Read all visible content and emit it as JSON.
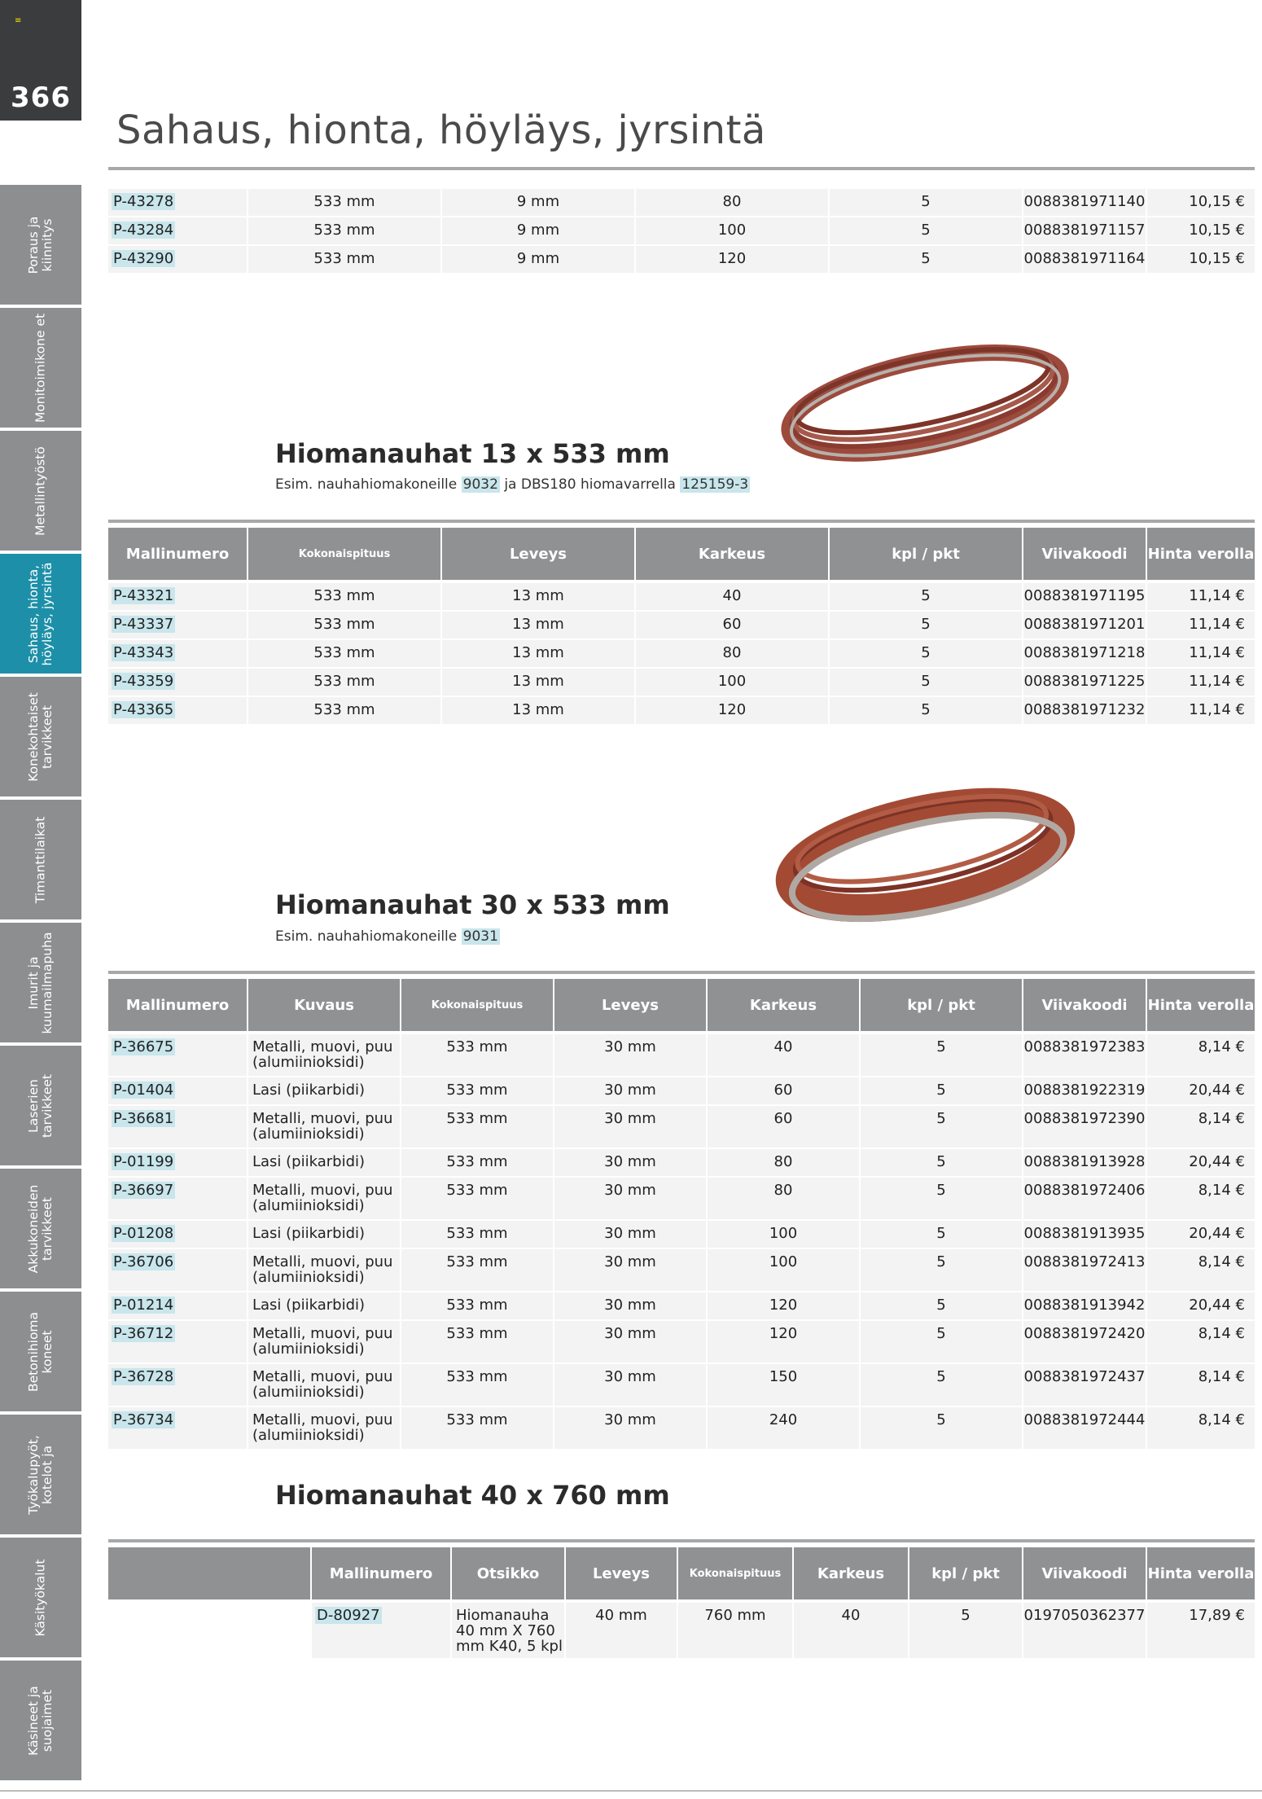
{
  "page": {
    "number": "366",
    "title": "Sahaus, hionta, höyläys, jyrsintä"
  },
  "side_tabs": [
    {
      "label": "Poraus ja kiinnitys",
      "active": false
    },
    {
      "label": "Monitoimikone et",
      "active": false
    },
    {
      "label": "Metallintyöstö",
      "active": false
    },
    {
      "label": "Sahaus, hionta, höyläys, jyrsintä",
      "active": true
    },
    {
      "label": "Konekohtaiset tarvikkeet",
      "active": false
    },
    {
      "label": "Timanttilaikat",
      "active": false
    },
    {
      "label": "Imurit ja kuumailmapuha",
      "active": false
    },
    {
      "label": "Laserien tarvikkeet",
      "active": false
    },
    {
      "label": "Akkukoneiden tarvikkeet",
      "active": false
    },
    {
      "label": "Betonihioma koneet",
      "active": false
    },
    {
      "label": "Työkalupyöt, kotelot ja",
      "active": false
    },
    {
      "label": "Käsityökalut",
      "active": false
    },
    {
      "label": "Käsineet ja suojaimet",
      "active": false
    }
  ],
  "table0": {
    "rows": [
      [
        "P-43278",
        "533 mm",
        "9 mm",
        "80",
        "5",
        "0088381971140",
        "10,15 €"
      ],
      [
        "P-43284",
        "533 mm",
        "9 mm",
        "100",
        "5",
        "0088381971157",
        "10,15 €"
      ],
      [
        "P-43290",
        "533 mm",
        "9 mm",
        "120",
        "5",
        "0088381971164",
        "10,15 €"
      ]
    ]
  },
  "section1": {
    "title": "Hiomanauhat 13 x 533 mm",
    "sub_prefix": "Esim. nauhahiomakoneille",
    "sub_link1": "9032",
    "sub_mid": "ja DBS180 hiomavarrella",
    "sub_link2": "125159-3",
    "headers": [
      "Mallinumero",
      "Kokonaispituus",
      "Leveys",
      "Karkeus",
      "kpl / pkt",
      "Viivakoodi",
      "Hinta verolla"
    ],
    "rows": [
      [
        "P-43321",
        "533 mm",
        "13 mm",
        "40",
        "5",
        "0088381971195",
        "11,14 €"
      ],
      [
        "P-43337",
        "533 mm",
        "13 mm",
        "60",
        "5",
        "0088381971201",
        "11,14 €"
      ],
      [
        "P-43343",
        "533 mm",
        "13 mm",
        "80",
        "5",
        "0088381971218",
        "11,14 €"
      ],
      [
        "P-43359",
        "533 mm",
        "13 mm",
        "100",
        "5",
        "0088381971225",
        "11,14 €"
      ],
      [
        "P-43365",
        "533 mm",
        "13 mm",
        "120",
        "5",
        "0088381971232",
        "11,14 €"
      ]
    ]
  },
  "section2": {
    "title": "Hiomanauhat 30 x 533 mm",
    "sub_prefix": "Esim. nauhahiomakoneille",
    "sub_link1": "9031",
    "headers": [
      "Mallinumero",
      "Kuvaus",
      "Kokonaispituus",
      "Leveys",
      "Karkeus",
      "kpl / pkt",
      "Viivakoodi",
      "Hinta verolla"
    ],
    "rows": [
      [
        "P-36675",
        "Metalli, muovi, puu (alumiinioksidi)",
        "533 mm",
        "30 mm",
        "40",
        "5",
        "0088381972383",
        "8,14 €"
      ],
      [
        "P-01404",
        "Lasi (piikarbidi)",
        "533 mm",
        "30 mm",
        "60",
        "5",
        "0088381922319",
        "20,44 €"
      ],
      [
        "P-36681",
        "Metalli, muovi, puu (alumiinioksidi)",
        "533 mm",
        "30 mm",
        "60",
        "5",
        "0088381972390",
        "8,14 €"
      ],
      [
        "P-01199",
        "Lasi (piikarbidi)",
        "533 mm",
        "30 mm",
        "80",
        "5",
        "0088381913928",
        "20,44 €"
      ],
      [
        "P-36697",
        "Metalli, muovi, puu (alumiinioksidi)",
        "533 mm",
        "30 mm",
        "80",
        "5",
        "0088381972406",
        "8,14 €"
      ],
      [
        "P-01208",
        "Lasi (piikarbidi)",
        "533 mm",
        "30 mm",
        "100",
        "5",
        "0088381913935",
        "20,44 €"
      ],
      [
        "P-36706",
        "Metalli, muovi, puu (alumiinioksidi)",
        "533 mm",
        "30 mm",
        "100",
        "5",
        "0088381972413",
        "8,14 €"
      ],
      [
        "P-01214",
        "Lasi (piikarbidi)",
        "533 mm",
        "30 mm",
        "120",
        "5",
        "0088381913942",
        "20,44 €"
      ],
      [
        "P-36712",
        "Metalli, muovi, puu (alumiinioksidi)",
        "533 mm",
        "30 mm",
        "120",
        "5",
        "0088381972420",
        "8,14 €"
      ],
      [
        "P-36728",
        "Metalli, muovi, puu (alumiinioksidi)",
        "533 mm",
        "30 mm",
        "150",
        "5",
        "0088381972437",
        "8,14 €"
      ],
      [
        "P-36734",
        "Metalli, muovi, puu (alumiinioksidi)",
        "533 mm",
        "30 mm",
        "240",
        "5",
        "0088381972444",
        "8,14 €"
      ]
    ]
  },
  "section3": {
    "title": "Hiomanauhat 40 x 760 mm",
    "headers": [
      "Mallinumero",
      "Otsikko",
      "Leveys",
      "Kokonaispituus",
      "Karkeus",
      "kpl / pkt",
      "Viivakoodi",
      "Hinta verolla"
    ],
    "rows": [
      [
        "D-80927",
        "Hiomanauha 40 mm X 760 mm K40, 5 kpl",
        "40 mm",
        "760 mm",
        "40",
        "5",
        "0197050362377",
        "17,89 €"
      ]
    ]
  },
  "colors": {
    "header_bg": "#8f9193",
    "row_bg": "#f3f3f3",
    "active_tab": "#1d8fa8",
    "link_hl": "#c8e6ec"
  }
}
